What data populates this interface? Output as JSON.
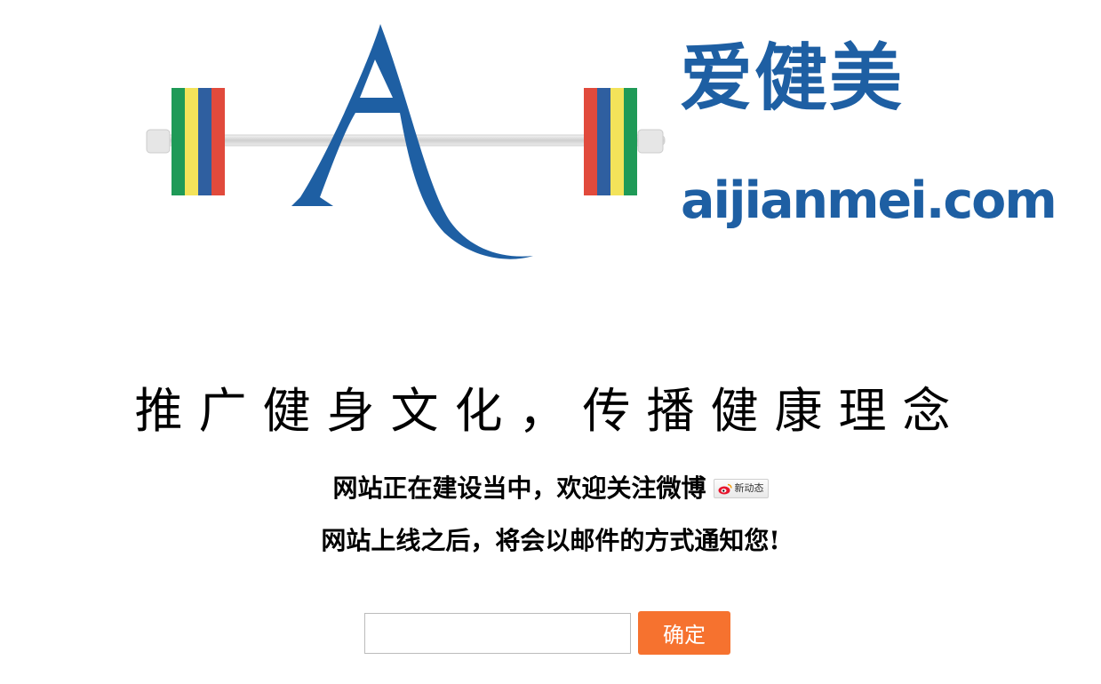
{
  "header": {
    "brand_cn": "爱健美",
    "brand_en": "aijianmei.com",
    "logo_icon": "barbell-letter-a-logo",
    "brand_color": "#1e5fa3"
  },
  "main": {
    "slogan": "推广健身文化，传播健康理念",
    "construction_text": "网站正在建设当中，欢迎关注微博",
    "weibo_button": {
      "icon": "weibo-icon",
      "label": "新动态"
    },
    "notify_text": "网站上线之后，将会以邮件的方式通知您!"
  },
  "subscribe": {
    "email_value": "",
    "email_placeholder": "",
    "submit_label": "确定",
    "submit_color": "#f6722f"
  }
}
